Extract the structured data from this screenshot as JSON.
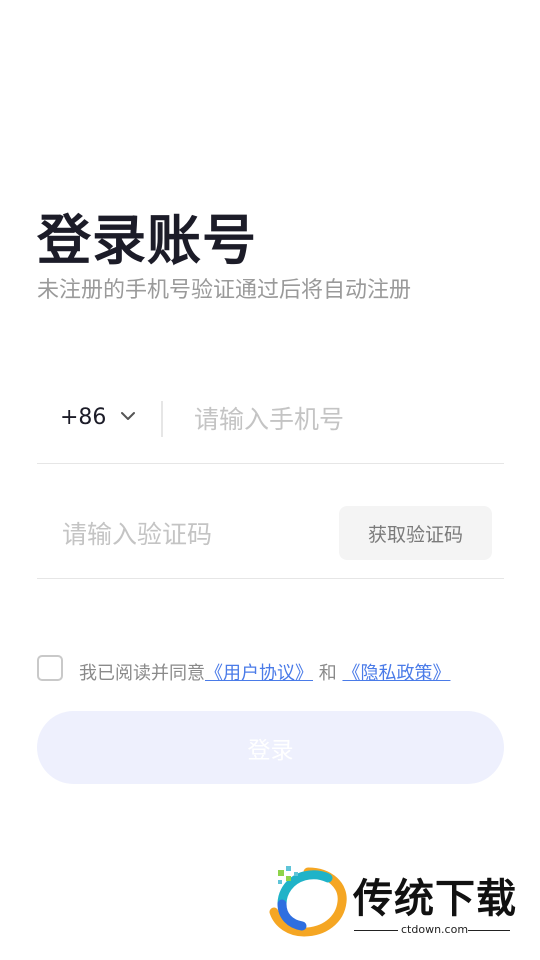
{
  "header": {
    "title": "登录账号",
    "subtitle": "未注册的手机号验证通过后将自动注册"
  },
  "phone": {
    "country_code": "+86",
    "placeholder": "请输入手机号",
    "value": ""
  },
  "code": {
    "placeholder": "请输入验证码",
    "value": "",
    "get_code_label": "获取验证码"
  },
  "agreement": {
    "checked": false,
    "prefix": "我已阅读并同意",
    "user_agreement": "《用户协议》",
    "and": "和",
    "privacy_policy": "《隐私政策》"
  },
  "login": {
    "label": "登录"
  },
  "watermark": {
    "name": "传统下载",
    "url": "ctdown.com"
  },
  "colors": {
    "accent_link": "#4a7be8",
    "login_bg": "#eef0fd",
    "title": "#1c1c28"
  }
}
